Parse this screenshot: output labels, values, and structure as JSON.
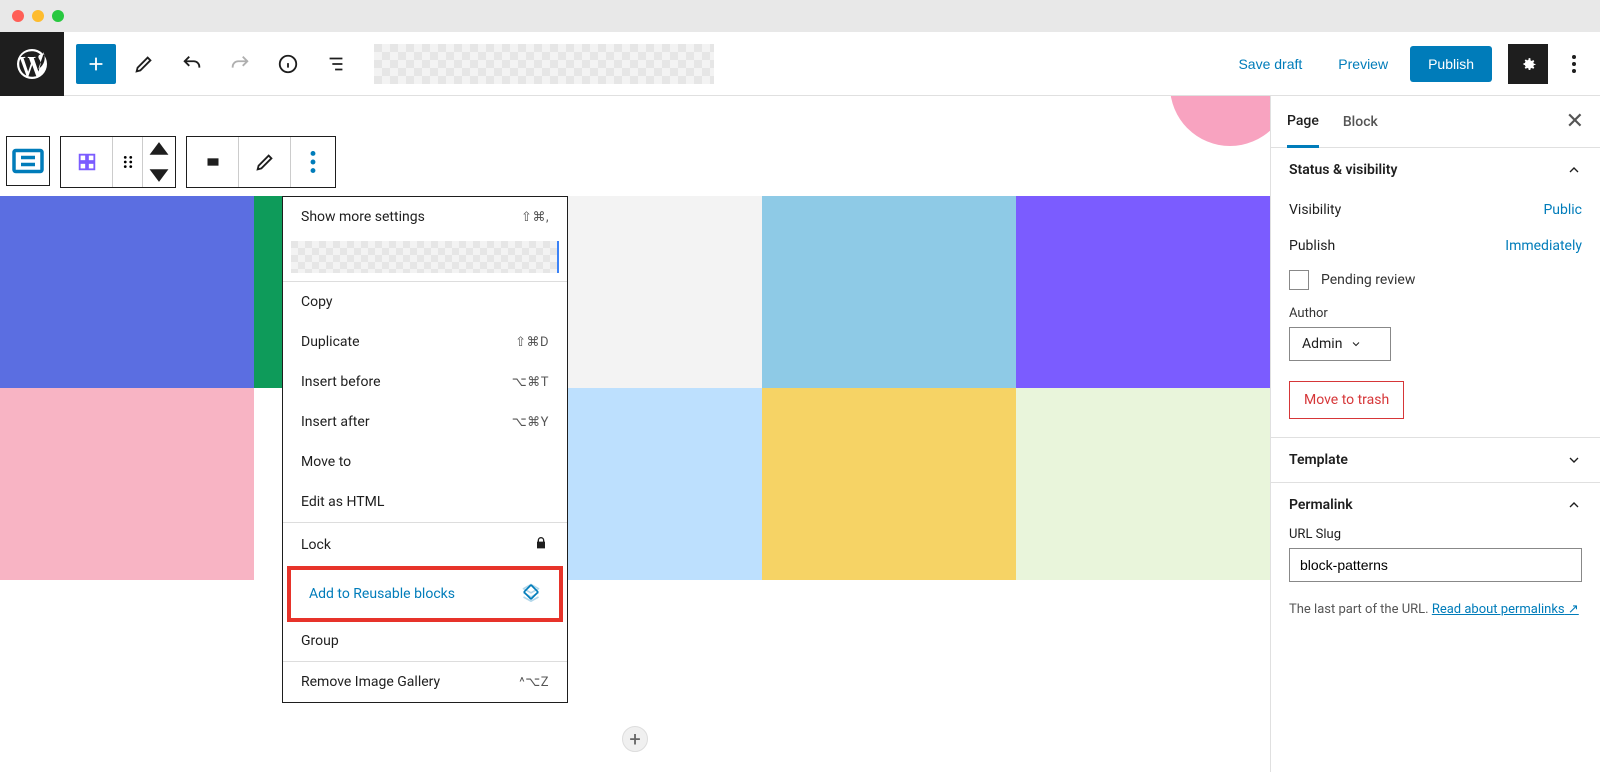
{
  "topbar": {
    "save_draft": "Save draft",
    "preview": "Preview",
    "publish": "Publish"
  },
  "context_menu": {
    "show_more": "Show more settings",
    "show_more_sc": "⇧⌘,",
    "copy": "Copy",
    "duplicate": "Duplicate",
    "duplicate_sc": "⇧⌘D",
    "insert_before": "Insert before",
    "insert_before_sc": "⌥⌘T",
    "insert_after": "Insert after",
    "insert_after_sc": "⌥⌘Y",
    "move_to": "Move to",
    "edit_html": "Edit as HTML",
    "lock": "Lock",
    "add_reusable": "Add to Reusable blocks",
    "group": "Group",
    "remove": "Remove Image Gallery",
    "remove_sc": "^⌥Z"
  },
  "sidebar": {
    "tabs": {
      "page": "Page",
      "block": "Block"
    },
    "status": {
      "title": "Status & visibility",
      "visibility_label": "Visibility",
      "visibility_value": "Public",
      "publish_label": "Publish",
      "publish_value": "Immediately",
      "pending": "Pending review",
      "author_label": "Author",
      "author_value": "Admin",
      "trash": "Move to trash"
    },
    "template": {
      "title": "Template"
    },
    "permalink": {
      "title": "Permalink",
      "slug_label": "URL Slug",
      "slug_value": "block-patterns",
      "help_prefix": "The last part of the URL. ",
      "help_link": "Read about permalinks"
    }
  }
}
